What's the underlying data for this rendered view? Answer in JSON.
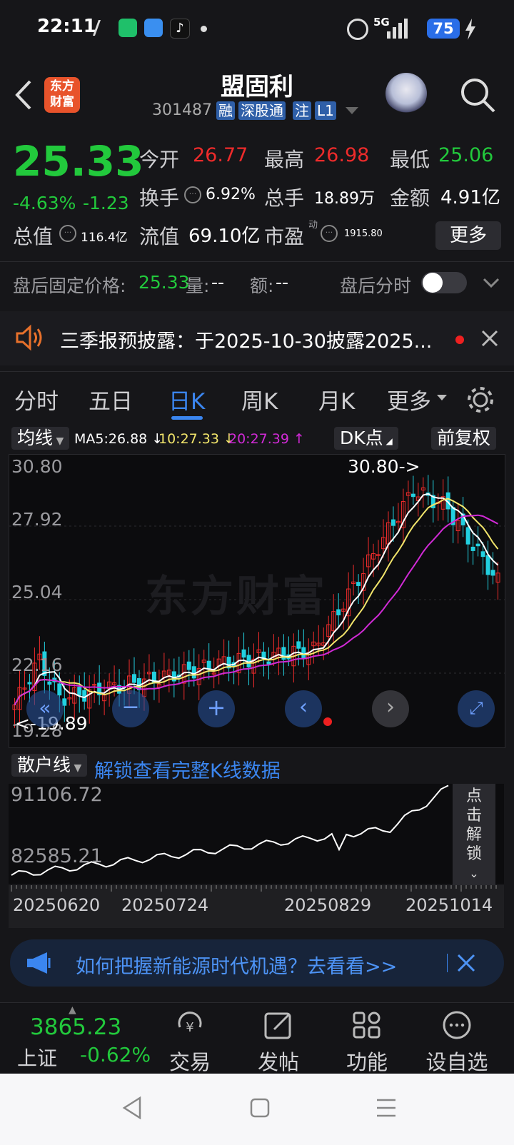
{
  "status": {
    "time": "22:11",
    "network": "5G",
    "battery": "75"
  },
  "header": {
    "back": "<",
    "logo_line1": "东方",
    "logo_line2": "财富",
    "stock_name": "盟固利",
    "stock_code": "301487",
    "tags": [
      "融",
      "深股通",
      "注",
      "L1"
    ]
  },
  "quote": {
    "price": "25.33",
    "change_pct": "-4.63%",
    "change": "-1.23",
    "open_label": "今开",
    "open": "26.77",
    "high_label": "最高",
    "high": "26.98",
    "low_label": "最低",
    "low": "25.06",
    "turnover_label": "换手",
    "turnover": "6.92%",
    "volume_label": "总手",
    "volume": "18.89万",
    "amount_label": "金额",
    "amount": "4.91亿",
    "mktcap_label": "总值",
    "mktcap": "116.4亿",
    "float_label": "流值",
    "float_cap": "69.10亿",
    "pe_label": "市盈",
    "pe_sup": "动",
    "pe": "1915.80",
    "more": "更多"
  },
  "after": {
    "fixed_label": "盘后固定价格:",
    "fixed_price": "25.33",
    "vol_label": "量:",
    "vol": "--",
    "amt_label": "额:",
    "amt": "--",
    "toggle_label": "盘后分时"
  },
  "notice": {
    "text": "三季报预披露：于2025-10-30披露2025..."
  },
  "tabs": [
    "分时",
    "五日",
    "日K",
    "周K",
    "月K",
    "更多"
  ],
  "chartbar": {
    "ma_btn": "均线",
    "ma5": "MA5:26.88",
    "ma10": "10:27.33",
    "ma20": "20:27.39",
    "dk": "DK点",
    "adjust": "前复权"
  },
  "kchart": {
    "y_labels": [
      "30.80",
      "27.92",
      "25.04",
      "22.16",
      "19.28"
    ],
    "max_label": "30.80->",
    "min_label": "<-19.89",
    "watermark": "东方财富"
  },
  "volbar": {
    "btn": "散户线",
    "unlock": "解锁查看完整K线数据"
  },
  "volchart": {
    "top": "91106.72",
    "bottom": "82585.21",
    "side": [
      "点",
      "击",
      "解",
      "锁"
    ]
  },
  "dates": [
    "20250620",
    "20250724",
    "20250829",
    "20251014"
  ],
  "ad": {
    "text": "如何把握新能源时代机遇？去看看>>"
  },
  "bottomnav": {
    "index_value": "3865.23",
    "index_name": "上证",
    "index_change": "-0.62%",
    "items": [
      "交易",
      "发帖",
      "功能",
      "设自选"
    ]
  },
  "colors": {
    "up": "#ee2b2b",
    "down": "#22c93c",
    "accent": "#3b86f0",
    "ma5": "#ffffff",
    "ma10": "#f2e56b",
    "ma20": "#d12ad6"
  }
}
